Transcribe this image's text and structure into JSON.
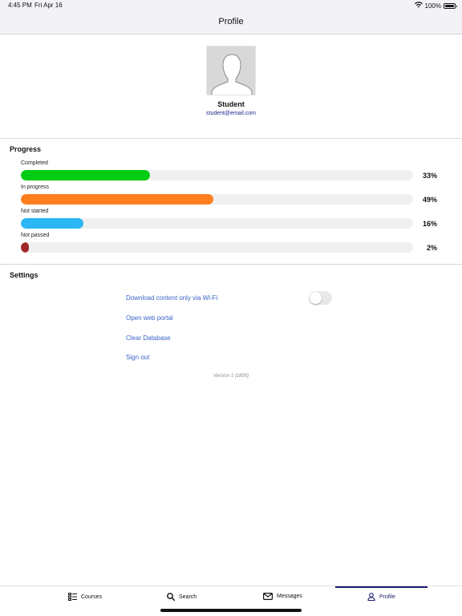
{
  "status_bar": {
    "time": "4:45 PM",
    "date": "Fri Apr 16",
    "battery": "100%",
    "icons": [
      "wifi-icon",
      "battery-icon"
    ]
  },
  "header": {
    "title": "Profile"
  },
  "profile": {
    "name": "Student",
    "email": "student@email.com",
    "avatar_icon": "person-silhouette-icon"
  },
  "progress": {
    "title": "Progress",
    "items": [
      {
        "label": "Completed",
        "percent_label": "33%",
        "value": 33,
        "color": "#00cc14"
      },
      {
        "label": "In progress",
        "percent_label": "49%",
        "value": 49,
        "color": "#ff7f1f"
      },
      {
        "label": "Not started",
        "percent_label": "16%",
        "value": 16,
        "color": "#2ab7f4"
      },
      {
        "label": "Not passed",
        "percent_label": "2%",
        "value": 2,
        "color": "#a02828"
      }
    ]
  },
  "settings": {
    "title": "Settings",
    "wifi_only_label": "Download content only via Wi-Fi",
    "wifi_only_enabled": false,
    "open_portal_label": "Open web portal",
    "clear_db_label": "Clear Database",
    "sign_out_label": "Sign out",
    "version": "Version 1 (1805)"
  },
  "tabs": [
    {
      "label": "Courses",
      "icon": "list-icon",
      "active": false
    },
    {
      "label": "Search",
      "icon": "search-icon",
      "active": false
    },
    {
      "label": "Messages",
      "icon": "envelope-icon",
      "active": false
    },
    {
      "label": "Profile",
      "icon": "person-icon",
      "active": true
    }
  ]
}
